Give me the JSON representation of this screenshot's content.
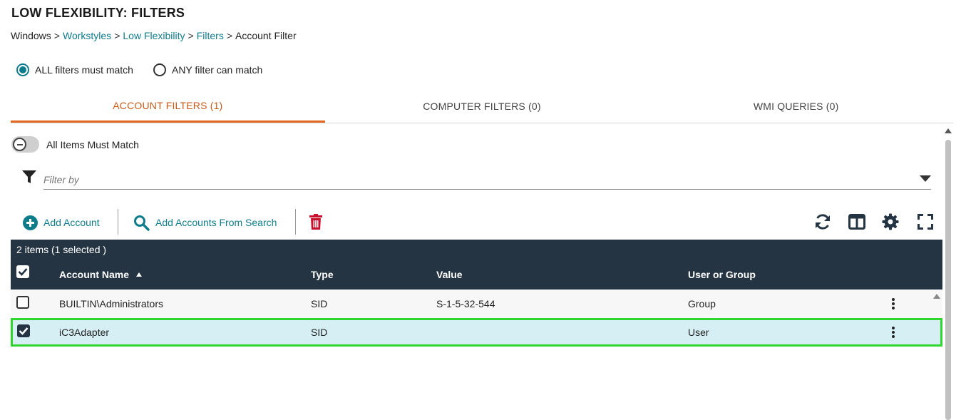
{
  "header": {
    "title": "LOW FLEXIBILITY: FILTERS",
    "breadcrumb": [
      {
        "label": "Windows",
        "link": false
      },
      {
        "label": "Workstyles",
        "link": true
      },
      {
        "label": "Low Flexibility",
        "link": true
      },
      {
        "label": "Filters",
        "link": true
      },
      {
        "label": "Account Filter",
        "link": false
      }
    ],
    "separator": ">"
  },
  "match_mode": {
    "options": [
      {
        "label": "ALL filters must match",
        "selected": true
      },
      {
        "label": "ANY filter can match",
        "selected": false
      }
    ]
  },
  "tabs": [
    {
      "label": "ACCOUNT FILTERS (1)",
      "active": true
    },
    {
      "label": "COMPUTER FILTERS (0)",
      "active": false
    },
    {
      "label": "WMI QUERIES (0)",
      "active": false
    }
  ],
  "toggle": {
    "label": "All Items Must Match",
    "on": false
  },
  "filter": {
    "placeholder": "Filter by"
  },
  "toolbar": {
    "add_account": "Add Account",
    "add_from_search": "Add Accounts From Search",
    "icons": [
      "trash-icon",
      "refresh-icon",
      "columns-icon",
      "gear-icon",
      "fullscreen-icon"
    ]
  },
  "grid": {
    "count_label": "2 items (1 selected )",
    "columns": [
      "Account Name",
      "Type",
      "Value",
      "User or Group"
    ],
    "rows": [
      {
        "account_name": "BUILTIN\\Administrators",
        "type": "SID",
        "value": "S-1-5-32-544",
        "user_or_group": "Group",
        "selected": false
      },
      {
        "account_name": "iC3Adapter",
        "type": "SID",
        "value": "",
        "user_or_group": "User",
        "selected": true
      }
    ]
  },
  "colors": {
    "accent": "#0f7c8c",
    "tab_active": "#e1671f",
    "grid_header": "#243443",
    "selected_row": "#d5eff4",
    "highlight_border": "#2fd62f",
    "delete": "#c8102e"
  }
}
